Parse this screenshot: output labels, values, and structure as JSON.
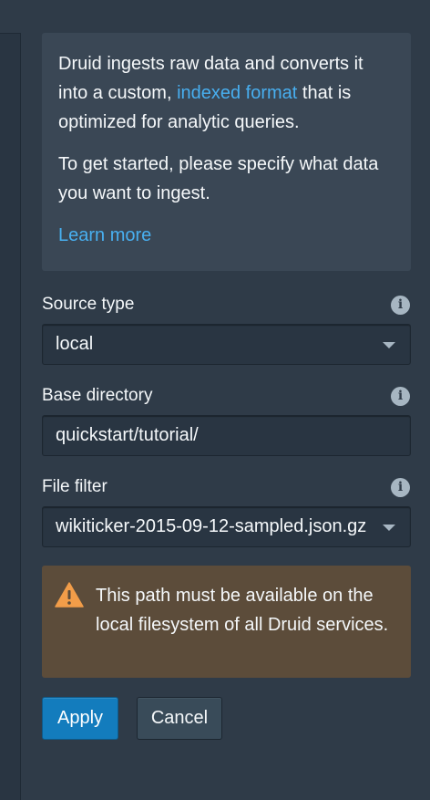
{
  "intro": {
    "line1_before_link": "Druid ingests raw data and converts it into a custom, ",
    "link_text": "indexed format",
    "line1_after_link": " that is optimized for analytic queries.",
    "paragraph2": "To get started, please specify what data you want to ingest.",
    "learn_more": "Learn more"
  },
  "fields": {
    "source_type": {
      "label": "Source type",
      "value": "local",
      "icon": "info-icon"
    },
    "base_directory": {
      "label": "Base directory",
      "value": "quickstart/tutorial/",
      "icon": "info-icon"
    },
    "file_filter": {
      "label": "File filter",
      "value": "wikiticker-2015-09-12-sampled.json.gz",
      "icon": "info-icon"
    }
  },
  "warning": {
    "text": "This path must be available on the local filesystem of all Druid services.",
    "icon": "warning-triangle-icon"
  },
  "buttons": {
    "apply": "Apply",
    "cancel": "Cancel"
  },
  "colors": {
    "background": "#2f3b48",
    "link": "#48aff0",
    "primary_button": "#137cbd",
    "warning_bg": "#5c4c3a",
    "warning_icon": "#f29d49"
  }
}
